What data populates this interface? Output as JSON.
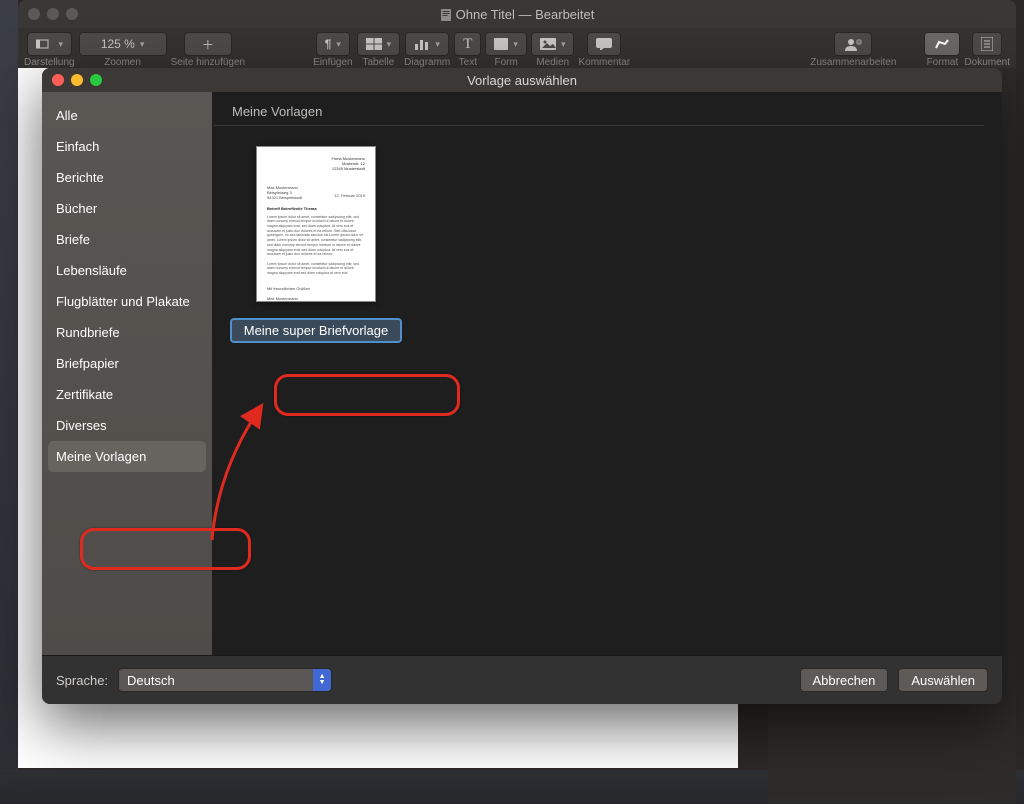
{
  "window": {
    "title": "Ohne Titel — Bearbeitet"
  },
  "toolbar": {
    "view": "Darstellung",
    "zoom_label": "Zoomen",
    "zoom_value": "125 %",
    "add_page": "Seite hinzufügen",
    "insert": "Einfügen",
    "table": "Tabelle",
    "chart": "Diagramm",
    "text": "Text",
    "shape": "Form",
    "media": "Medien",
    "comment": "Kommentar",
    "collaborate": "Zusammenarbeiten",
    "format": "Format",
    "document": "Dokument"
  },
  "modal": {
    "title": "Vorlage auswählen",
    "content_header": "Meine Vorlagen",
    "sidebar": [
      "Alle",
      "Einfach",
      "Berichte",
      "Bücher",
      "Briefe",
      "Lebensläufe",
      "Flugblätter und Plakate",
      "Rundbriefe",
      "Briefpapier",
      "Zertifikate",
      "Diverses",
      "Meine Vorlagen"
    ],
    "sidebar_selected": 11,
    "template_name": "Meine super Briefvorlage",
    "language_label": "Sprache:",
    "language_value": "Deutsch",
    "cancel": "Abbrechen",
    "choose": "Auswählen"
  }
}
